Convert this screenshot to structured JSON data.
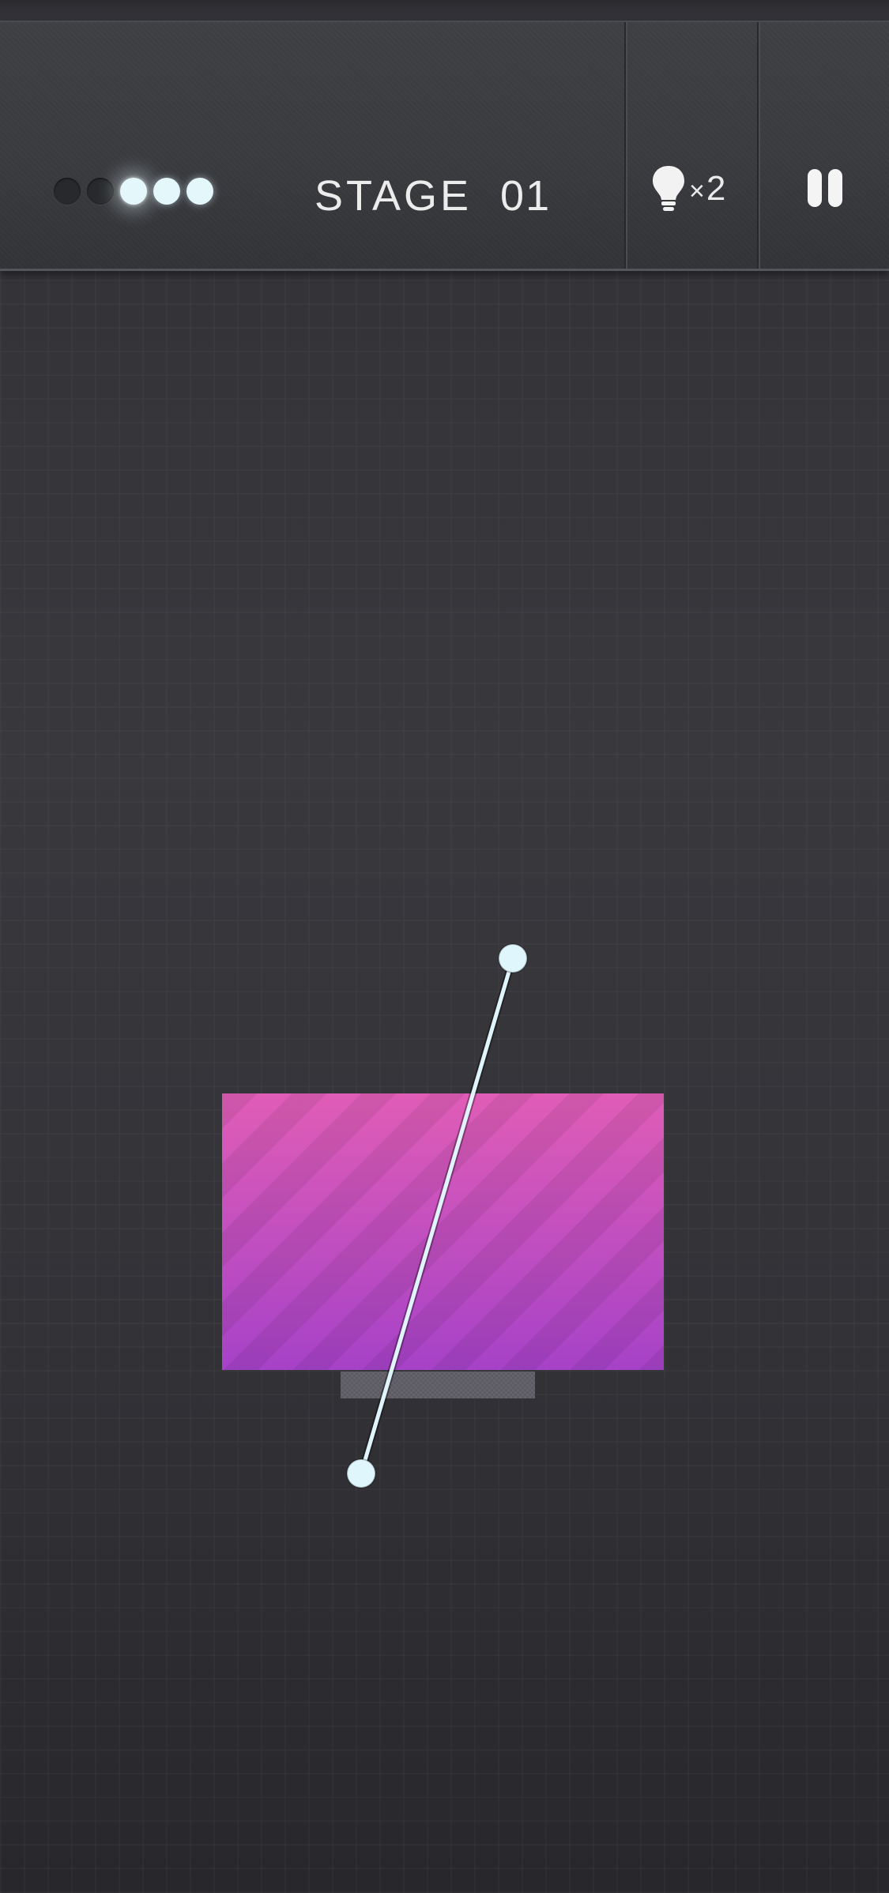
{
  "header": {
    "stage_label": "STAGE",
    "stage_number": "01",
    "progress": {
      "total": 5,
      "completed": 2
    },
    "hint": {
      "times_symbol": "×",
      "count": "2"
    }
  },
  "colors": {
    "dot_on": "#e4f7fb",
    "dot_off": "#28292c",
    "block_top": "#e05db6",
    "block_bottom": "#a642c8",
    "cut_line": "#dff5fb",
    "handle": "#dff7fc"
  },
  "icons": {
    "hint": "lightbulb-icon",
    "pause": "pause-icon"
  }
}
